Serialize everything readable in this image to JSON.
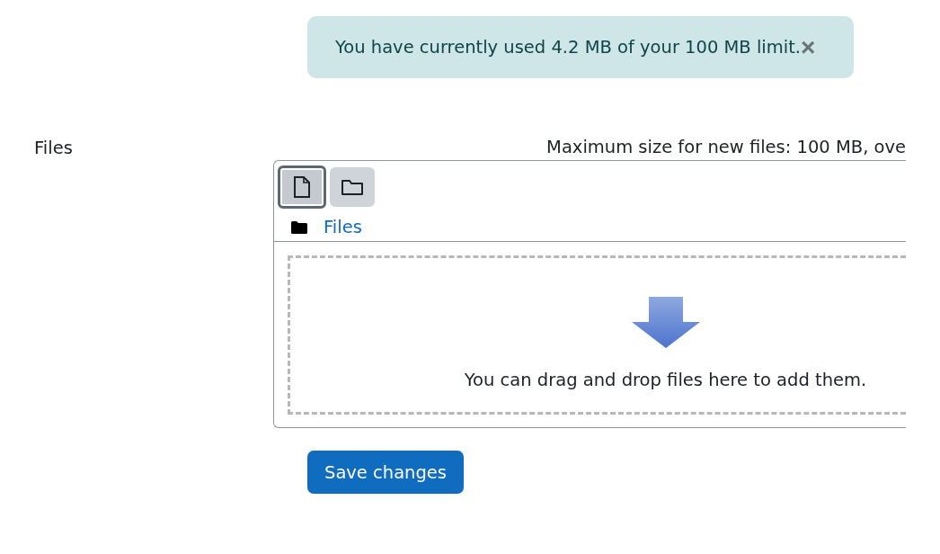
{
  "alert": {
    "message": "You have currently used 4.2 MB of your 100 MB limit.",
    "close": "×"
  },
  "files_field": {
    "label": "Files",
    "limits": "Maximum size for new files: 100 MB, ove",
    "toolbar": [
      {
        "kind": "file",
        "focused": true
      },
      {
        "kind": "folder",
        "focused": false
      }
    ],
    "path": "Files",
    "drop_hint": "You can drag and drop files here to add them."
  },
  "buttons": [
    "Save changes"
  ]
}
